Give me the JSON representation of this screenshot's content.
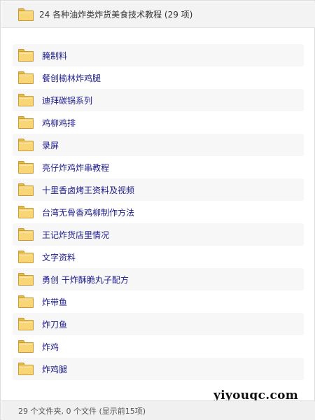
{
  "header": {
    "title": "24 各种油炸类炸货美食技术教程 (29 项)"
  },
  "folders": [
    {
      "label": "腌制料"
    },
    {
      "label": "餐创榆林炸鸡腿"
    },
    {
      "label": "迪拜碳锅系列"
    },
    {
      "label": "鸡柳鸡排"
    },
    {
      "label": "录屏"
    },
    {
      "label": "亮仔炸鸡炸串教程"
    },
    {
      "label": "十里香卤烤王资料及视频"
    },
    {
      "label": "台湾无骨香鸡柳制作方法"
    },
    {
      "label": "王记炸货店里情况"
    },
    {
      "label": "文字资料"
    },
    {
      "label": "勇创  干炸酥脆丸子配方"
    },
    {
      "label": "炸带鱼"
    },
    {
      "label": "炸刀鱼"
    },
    {
      "label": "炸鸡"
    },
    {
      "label": "炸鸡腿"
    }
  ],
  "statusbar": {
    "text": "29 个文件夹, 0 个文件 (显示前15项)"
  },
  "watermark": {
    "text": "yiyouqc.com"
  },
  "icons": {
    "folder": "folder-icon"
  },
  "colors": {
    "folder_fill": "#f8d675",
    "label_text": "#1a1a8c"
  }
}
